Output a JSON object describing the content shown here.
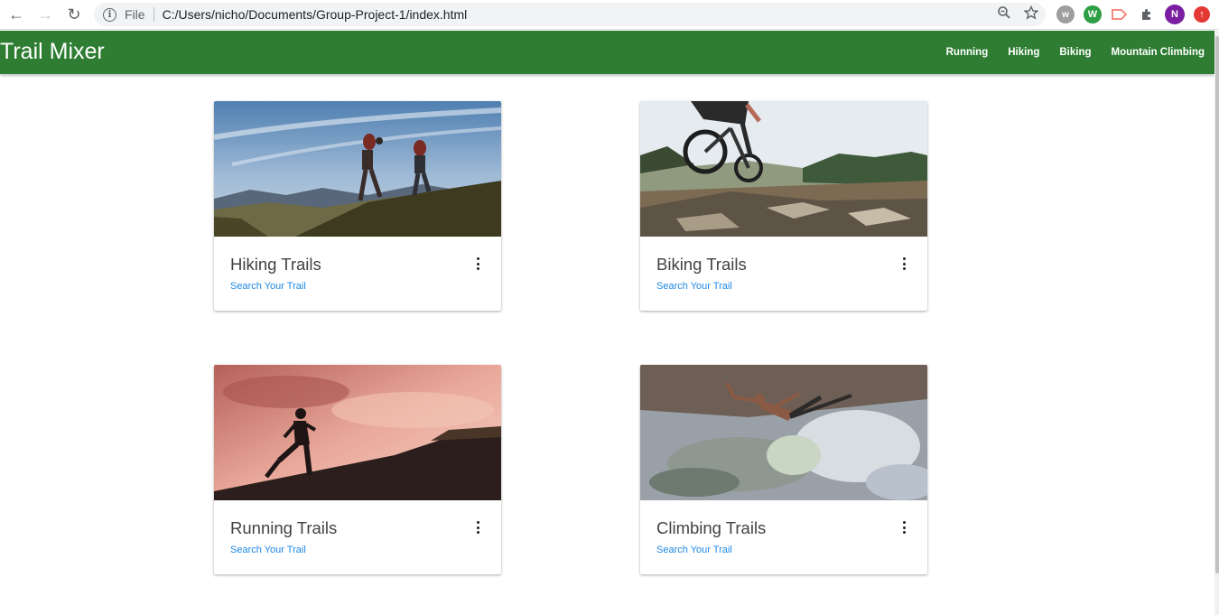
{
  "browser": {
    "file_label": "File",
    "url": "C:/Users/nicho/Documents/Group-Project-1/index.html",
    "extensions": [
      {
        "label": "w",
        "color": "#9e9e9e"
      },
      {
        "label": "W",
        "color": "#2e9e44"
      },
      {
        "label": "",
        "color": "#f28b82"
      },
      {
        "label": "",
        "color": "#5f6368"
      },
      {
        "label": "N",
        "color": "#7b1fa2"
      },
      {
        "label": "",
        "color": "#e53935"
      }
    ]
  },
  "navbar": {
    "brand": "Trail Mixer",
    "links": [
      "Running",
      "Hiking",
      "Biking",
      "Mountain Climbing"
    ],
    "bg_color": "#2e7d32"
  },
  "cards": [
    {
      "title": "Hiking Trails",
      "link": "Search Your Trail",
      "image": "hikers-on-ridge-photo"
    },
    {
      "title": "Biking Trails",
      "link": "Search Your Trail",
      "image": "mountain-biker-photo"
    },
    {
      "title": "Running Trails",
      "link": "Search Your Trail",
      "image": "runner-silhouette-photo"
    },
    {
      "title": "Climbing Trails",
      "link": "Search Your Trail",
      "image": "rock-climber-photo"
    }
  ]
}
